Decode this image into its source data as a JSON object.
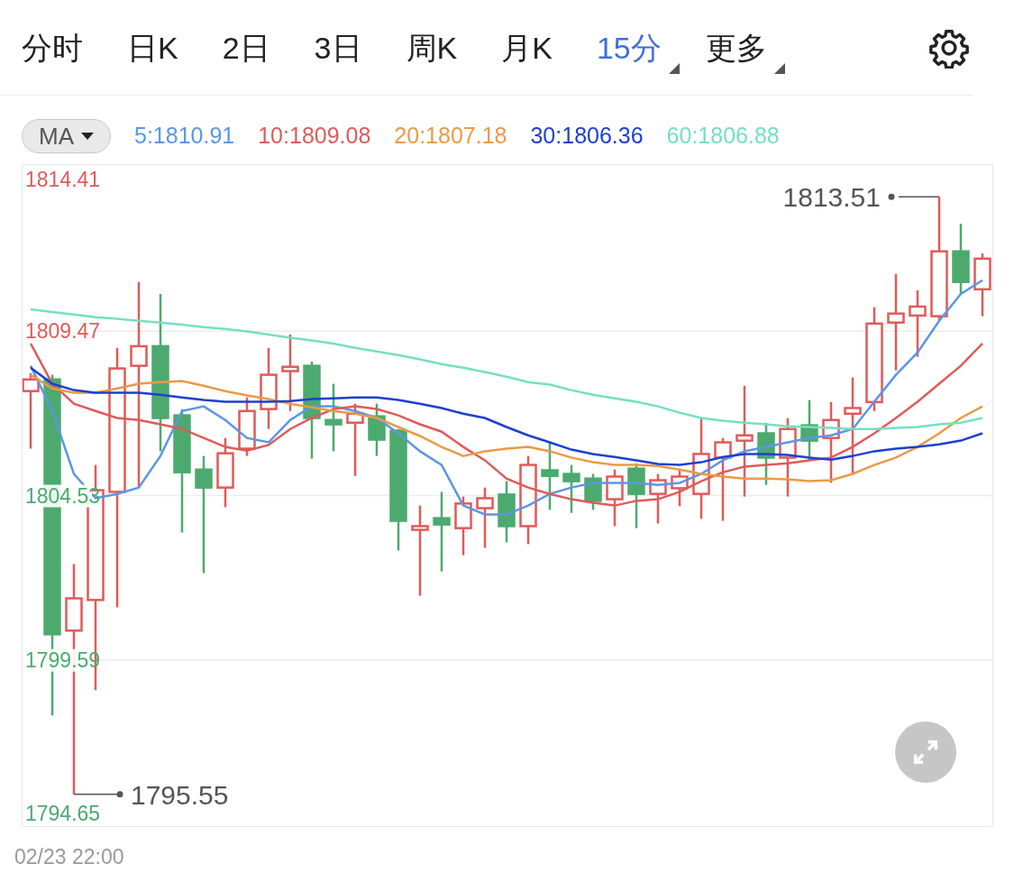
{
  "tabs": [
    {
      "label": "分时",
      "selected": false,
      "menu": false
    },
    {
      "label": "日K",
      "selected": false,
      "menu": false
    },
    {
      "label": "2日",
      "selected": false,
      "menu": false
    },
    {
      "label": "3日",
      "selected": false,
      "menu": false
    },
    {
      "label": "周K",
      "selected": false,
      "menu": false
    },
    {
      "label": "月K",
      "selected": false,
      "menu": false
    },
    {
      "label": "15分",
      "selected": true,
      "menu": true
    },
    {
      "label": "更多",
      "selected": false,
      "menu": true
    }
  ],
  "indicator_select": {
    "label": "MA"
  },
  "chart": {
    "chart_data": {
      "type": "line",
      "ylim": [
        1794.65,
        1814.41
      ],
      "grid": true,
      "yticks": [
        {
          "value": 1814.41,
          "label": "1814.41"
        },
        {
          "value": 1809.47,
          "label": "1809.47"
        },
        {
          "value": 1804.53,
          "label": "1804.53"
        },
        {
          "value": 1799.59,
          "label": "1799.59"
        },
        {
          "value": 1794.65,
          "label": "1794.65"
        }
      ],
      "series": [
        {
          "name": "5:1810.91",
          "color": "#5b97e3",
          "values": [
            1808.43,
            1807.07,
            1805.18,
            1804.45,
            1804.58,
            1804.77,
            1805.72,
            1807.07,
            1807.21,
            1806.8,
            1806.26,
            1806.13,
            1806.8,
            1807.21,
            1807.21,
            1807.07,
            1806.86,
            1806.4,
            1805.86,
            1805.45,
            1804.23,
            1803.96,
            1803.96,
            1804.23,
            1804.58,
            1804.77,
            1804.91,
            1804.91,
            1804.91,
            1804.85,
            1804.91,
            1805.18,
            1805.59,
            1805.86,
            1805.99,
            1806.13,
            1806.26,
            1806.34,
            1806.53,
            1807.35,
            1808.16,
            1808.83,
            1809.78,
            1810.59,
            1811.0
          ]
        },
        {
          "name": "10:1809.08",
          "color": "#e05a5a",
          "values": [
            1809.1,
            1807.89,
            1807.29,
            1807.07,
            1806.86,
            1806.8,
            1806.67,
            1806.53,
            1806.26,
            1805.99,
            1805.88,
            1806.05,
            1806.53,
            1806.86,
            1807.13,
            1807.21,
            1807.13,
            1806.94,
            1806.67,
            1806.45,
            1805.99,
            1805.59,
            1805.04,
            1804.77,
            1804.58,
            1804.42,
            1804.31,
            1804.23,
            1804.37,
            1804.42,
            1804.64,
            1804.96,
            1805.23,
            1805.4,
            1805.45,
            1805.5,
            1805.59,
            1805.67,
            1805.99,
            1806.4,
            1806.86,
            1807.35,
            1807.89,
            1808.43,
            1809.1
          ]
        },
        {
          "name": "20:1807.18",
          "color": "#eb9a45",
          "values": [
            1808.16,
            1807.75,
            1807.62,
            1807.62,
            1807.75,
            1807.89,
            1807.94,
            1807.97,
            1807.83,
            1807.67,
            1807.54,
            1807.43,
            1807.29,
            1807.18,
            1807.07,
            1806.99,
            1806.86,
            1806.59,
            1806.32,
            1805.99,
            1805.72,
            1805.86,
            1805.94,
            1805.99,
            1805.86,
            1805.67,
            1805.53,
            1805.45,
            1805.45,
            1805.42,
            1805.31,
            1805.18,
            1805.1,
            1805.04,
            1805.04,
            1805.02,
            1804.96,
            1804.99,
            1805.18,
            1805.45,
            1805.67,
            1805.99,
            1806.4,
            1806.86,
            1807.21
          ]
        },
        {
          "name": "30:1806.36",
          "color": "#1e3fd1",
          "values": [
            1808.37,
            1807.89,
            1807.7,
            1807.62,
            1807.62,
            1807.62,
            1807.56,
            1807.48,
            1807.4,
            1807.35,
            1807.35,
            1807.35,
            1807.37,
            1807.43,
            1807.45,
            1807.48,
            1807.48,
            1807.4,
            1807.29,
            1807.16,
            1806.99,
            1806.86,
            1806.59,
            1806.34,
            1806.13,
            1805.91,
            1805.78,
            1805.69,
            1805.59,
            1805.48,
            1805.45,
            1805.53,
            1805.69,
            1805.78,
            1805.78,
            1805.75,
            1805.67,
            1805.61,
            1805.72,
            1805.86,
            1805.94,
            1805.99,
            1806.07,
            1806.18,
            1806.4
          ]
        },
        {
          "name": "60:1806.88",
          "color": "#74e0c2",
          "values": [
            1810.13,
            1810.05,
            1809.97,
            1809.89,
            1809.84,
            1809.78,
            1809.73,
            1809.67,
            1809.59,
            1809.54,
            1809.46,
            1809.37,
            1809.27,
            1809.19,
            1809.1,
            1808.97,
            1808.86,
            1808.75,
            1808.62,
            1808.48,
            1808.37,
            1808.24,
            1808.1,
            1807.94,
            1807.86,
            1807.7,
            1807.56,
            1807.45,
            1807.35,
            1807.21,
            1807.02,
            1806.86,
            1806.78,
            1806.72,
            1806.67,
            1806.61,
            1806.59,
            1806.56,
            1806.53,
            1806.53,
            1806.56,
            1806.59,
            1806.67,
            1806.72,
            1806.86
          ]
        }
      ],
      "annotations": [
        "1813.51",
        "1795.55"
      ]
    }
  },
  "time_label": "02/23 22:00"
}
